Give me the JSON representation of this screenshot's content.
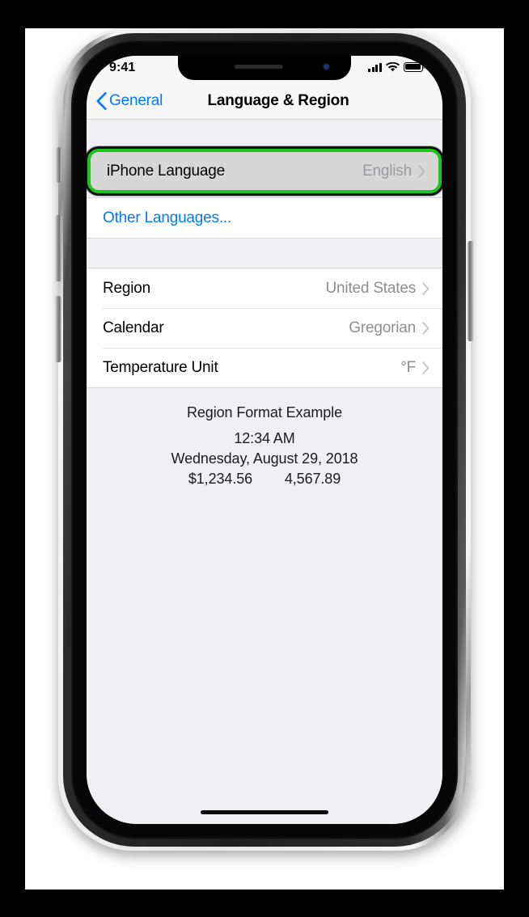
{
  "device": {
    "name": "iphone-x",
    "buttons": [
      "silent-switch",
      "volume-up",
      "volume-down",
      "power"
    ]
  },
  "status_bar": {
    "time": "9:41",
    "cellular_icon": "cellular-bars-icon",
    "cellular_bars": 4,
    "wifi_icon": "wifi-icon",
    "battery_icon": "battery-full-icon"
  },
  "nav": {
    "back_icon": "chevron-left-icon",
    "back_label": "General",
    "title": "Language & Region",
    "back_color": "#007aff"
  },
  "highlight": {
    "color": "#20c420",
    "target": "iphone-language-row"
  },
  "sections": [
    {
      "id": "language-section",
      "rows": [
        {
          "id": "iphone-language",
          "label": "iPhone Language",
          "value": "English",
          "accessory": "chevron-right-icon",
          "highlighted": true,
          "link": false
        },
        {
          "id": "other-languages",
          "label": "Other Languages...",
          "value": "",
          "accessory": "",
          "highlighted": false,
          "link": true
        }
      ]
    },
    {
      "id": "region-section",
      "rows": [
        {
          "id": "region",
          "label": "Region",
          "value": "United States",
          "accessory": "chevron-right-icon",
          "highlighted": false,
          "link": false
        },
        {
          "id": "calendar",
          "label": "Calendar",
          "value": "Gregorian",
          "accessory": "chevron-right-icon",
          "highlighted": false,
          "link": false
        },
        {
          "id": "temperature-unit",
          "label": "Temperature Unit",
          "value": "°F",
          "accessory": "chevron-right-icon",
          "highlighted": false,
          "link": false
        }
      ]
    }
  ],
  "footer": {
    "title": "Region Format Example",
    "time": "12:34 AM",
    "date": "Wednesday, August 29, 2018",
    "currency": "$1,234.56",
    "number": "4,567.89"
  },
  "home_indicator": "home-indicator"
}
